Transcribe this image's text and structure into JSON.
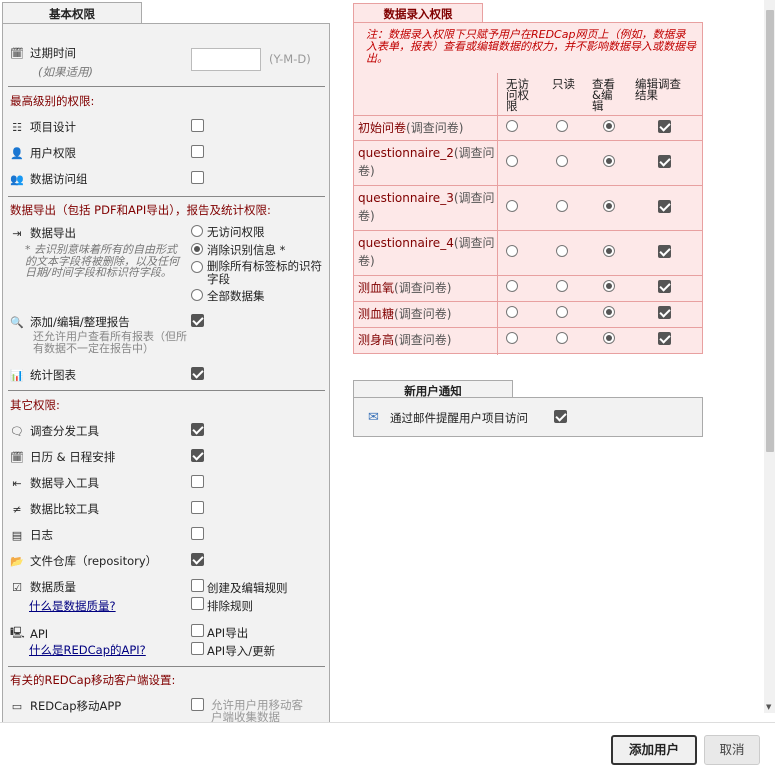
{
  "basic": {
    "tab": "基本权限",
    "expiration_label": "过期时间",
    "expiration_sub": "(如果适用)",
    "expiration_value": "",
    "expiration_format": "(Y-M-D)",
    "highest_section": "最高级别的权限:",
    "project_design": "项目设计",
    "user_rights": "用户权限",
    "dag": "数据访问组",
    "export_section": "数据导出（包括 PDF和API导出），报告及统计权限:",
    "data_export": "数据导出",
    "export_note": "* 去识别意味着所有的自由形式的文本字段将被删除，以及任何日期/时间字段和标识符字段。",
    "export_options": [
      "无访问权限",
      "消除识别信息 *",
      "删除所有标签标的识符字段",
      "全部数据集"
    ],
    "export_selected": 1,
    "reports": "添加/编辑/整理报告",
    "reports_note": "还允许用户查看所有报表（但所有数据不一定在报告中）",
    "stats": "统计图表",
    "other_section": "其它权限:",
    "survey_tools": "调查分发工具",
    "calendar": "日历 & 日程安排",
    "data_import": "数据导入工具",
    "data_compare": "数据比较工具",
    "logging": "日志",
    "file_repo": "文件仓库（repository）",
    "data_quality": "数据质量",
    "data_quality_link": "什么是数据质量?",
    "dq_opt1": "创建及编辑规则",
    "dq_opt2": "排除规则",
    "api": "API",
    "api_link": "什么是REDCap的API?",
    "api_opt1": "API导出",
    "api_opt2": "API导入/更新",
    "mobile_section": "有关的REDCap移动客户端设置:",
    "mobile_app": "REDCap移动APP",
    "mobile_opt": "允许用户用移动客户端收集数据"
  },
  "data_entry": {
    "tab": "数据录入权限",
    "note": "注：数据录入权限下只赋予用户在REDCap网页上（例如，数据录入表单，报表）查看或编辑数据的权力，并不影响数据导入或数据导出。",
    "col1": "无访问权限",
    "col2": "只读",
    "col3": "查看&编辑",
    "col4": "编辑调查结果",
    "forms": [
      {
        "name": "初始问卷",
        "sub": "(调查问卷)"
      },
      {
        "name": "questionnaire_2",
        "sub": "(调查问卷)"
      },
      {
        "name": "questionnaire_3",
        "sub": "(调查问卷)"
      },
      {
        "name": "questionnaire_4",
        "sub": "(调查问卷)"
      },
      {
        "name": "测血氧",
        "sub": "(调查问卷)"
      },
      {
        "name": "测血糖",
        "sub": "(调查问卷)"
      },
      {
        "name": "测身高",
        "sub": "(调查问卷)"
      }
    ]
  },
  "notify": {
    "tab": "新用户通知",
    "label": "通过邮件提醒用户项目访问"
  },
  "footer": {
    "add": "添加用户",
    "cancel": "取消"
  }
}
